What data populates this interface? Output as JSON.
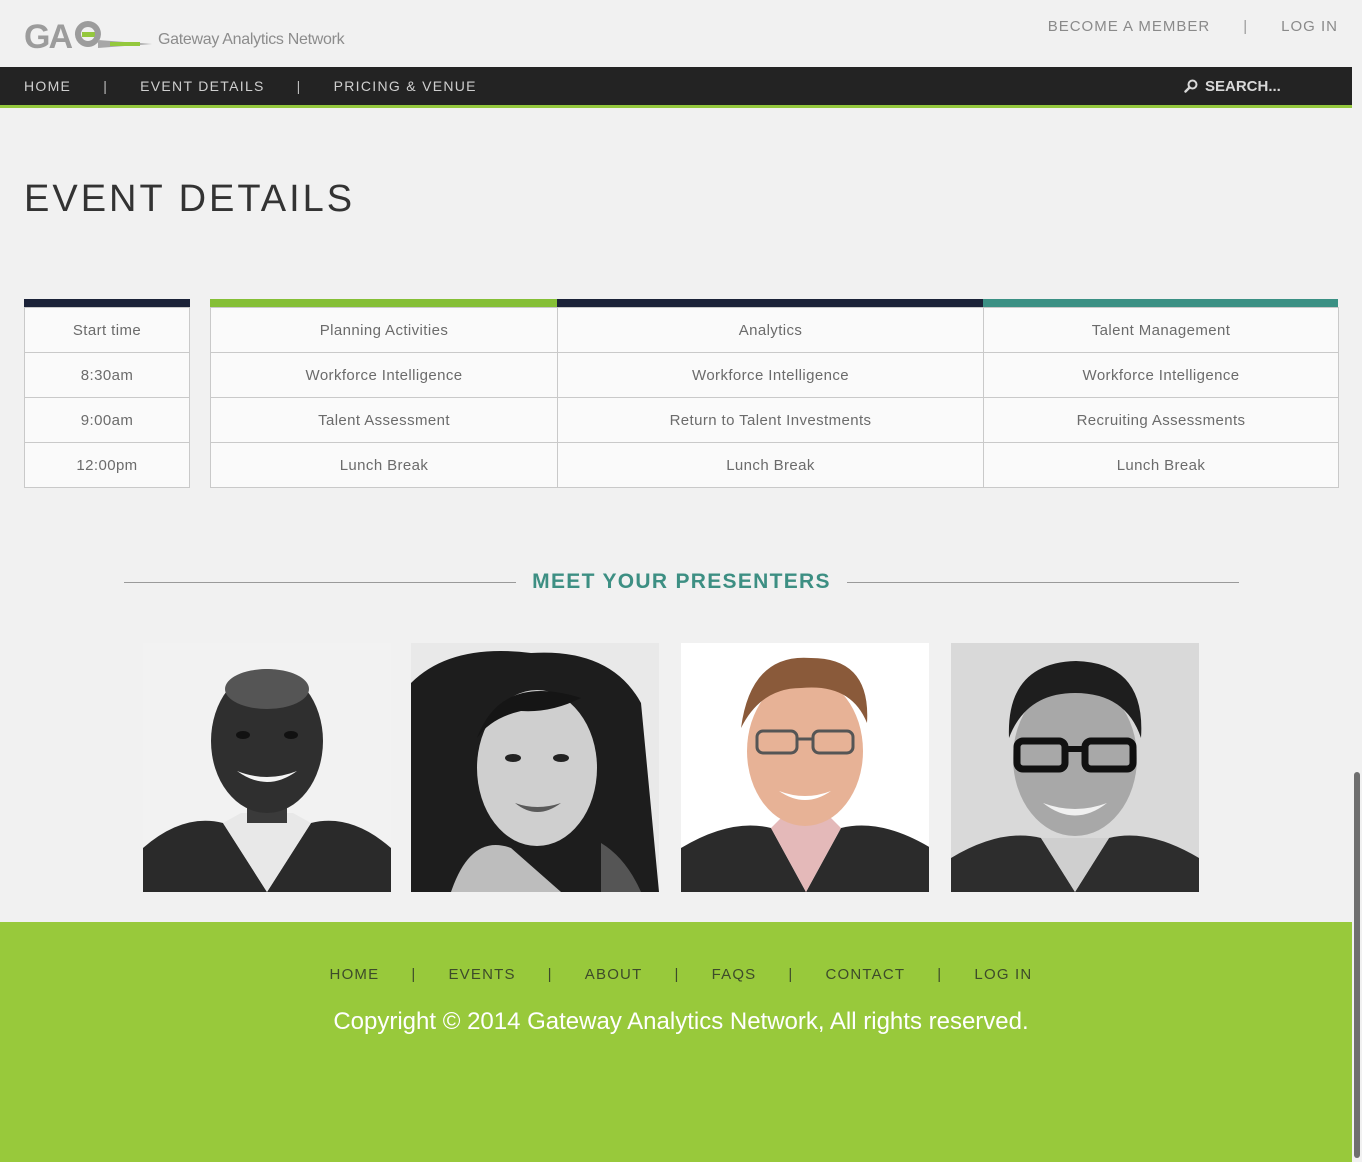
{
  "header": {
    "logo_text": "Gateway Analytics Network",
    "logo_mark": "GAN",
    "links": [
      "BECOME A MEMBER",
      "LOG IN"
    ]
  },
  "nav": {
    "items": [
      "HOME",
      "EVENT DETAILS",
      "PRICING & VENUE"
    ],
    "search_label": "SEARCH..."
  },
  "page": {
    "title": "EVENT DETAILS"
  },
  "schedule": {
    "time_header": "Start time",
    "times": [
      "8:30am",
      "9:00am",
      "12:00pm"
    ],
    "tracks": [
      {
        "name": "Planning Activities",
        "color": "#85bf36",
        "sessions": [
          "Workforce Intelligence",
          "Talent Assessment",
          "Lunch Break"
        ]
      },
      {
        "name": "Analytics",
        "color": "#1b2238",
        "sessions": [
          "Workforce Intelligence",
          "Return to Talent Investments",
          "Lunch Break"
        ]
      },
      {
        "name": "Talent Management",
        "color": "#3b9084",
        "sessions": [
          "Workforce Intelligence",
          "Recruiting Assessments",
          "Lunch Break"
        ]
      }
    ],
    "time_color": "#1b2238"
  },
  "presenters": {
    "heading": "MEET YOUR PRESENTERS",
    "photos": [
      "presenter-1-photo",
      "presenter-2-photo",
      "presenter-3-photo",
      "presenter-4-photo"
    ]
  },
  "footer": {
    "links": [
      "HOME",
      "EVENTS",
      "ABOUT",
      "FAQS",
      "CONTACT",
      "LOG IN"
    ],
    "copyright": "Copyright © 2014 Gateway Analytics Network, All rights reserved."
  },
  "colors": {
    "accent_green": "#98c93b",
    "nav_dark": "#232323",
    "teal": "#3d8f83"
  }
}
